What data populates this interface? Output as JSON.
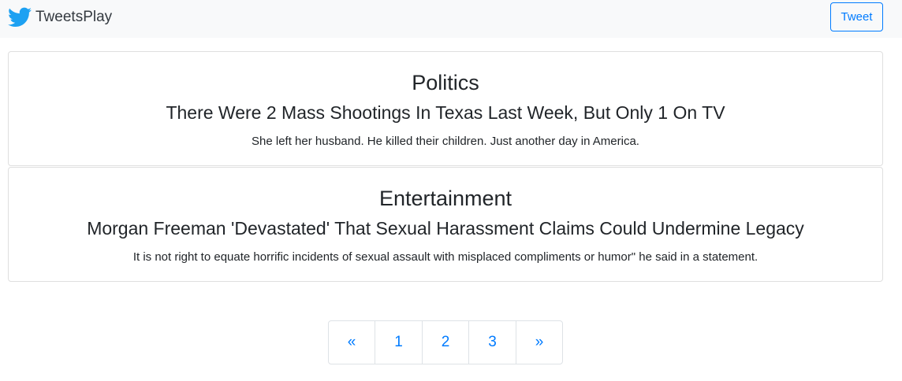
{
  "navbar": {
    "brand_icon": "twitter-bird-icon",
    "brand_name": "TweetsPlay",
    "tweet_button_label": "Tweet",
    "background_color": "#f8f9fa",
    "accent_color": "#007bff"
  },
  "articles": [
    {
      "category": "Politics",
      "title": "There Were 2 Mass Shootings In Texas Last Week, But Only 1 On TV",
      "summary": "She left her husband. He killed their children. Just another day in America."
    },
    {
      "category": "Entertainment",
      "title": "Morgan Freeman 'Devastated' That Sexual Harassment Claims Could Undermine Legacy",
      "summary": "It is not right to equate horrific incidents of sexual assault with misplaced compliments or humor\" he said in a statement."
    }
  ],
  "pagination": {
    "previous": "«",
    "pages": [
      "1",
      "2",
      "3"
    ],
    "next": "»"
  }
}
